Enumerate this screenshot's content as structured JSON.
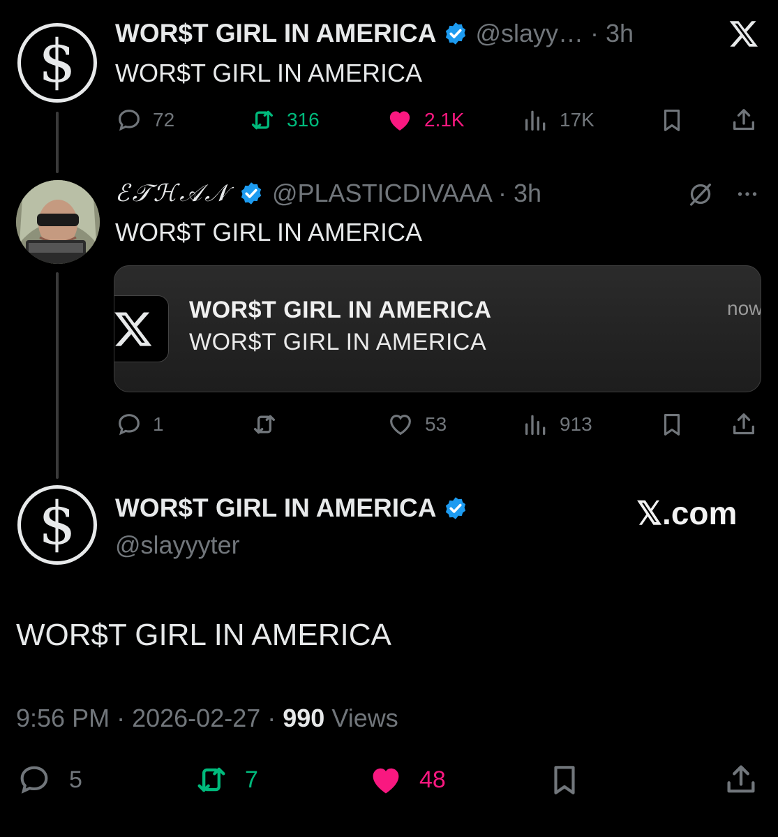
{
  "tweet1": {
    "name": "WOR$T GIRL IN AMERICA",
    "handle_time": "@slayy… · 3h",
    "text": "WOR$T GIRL IN AMERICA",
    "replies": "72",
    "retweets": "316",
    "likes": "2.1K",
    "views": "17K",
    "avatar_icon": "dollar-sign-icon"
  },
  "tweet2": {
    "name": "ℰ𝒯ℋ𝒜𝒩",
    "handle_time": "@PLASTICDIVAAA · 3h",
    "text": "WOR$T GIRL IN AMERICA",
    "replies": "1",
    "likes": "53",
    "views": "913",
    "notification": {
      "title": "WOR$T GIRL IN AMERICA",
      "body": "WOR$T GIRL IN AMERICA",
      "time": "now"
    }
  },
  "main_tweet": {
    "name": "WOR$T GIRL IN AMERICA",
    "handle": "@slayyyter",
    "text": "WOR$T GIRL IN AMERICA",
    "time": "9:56 PM",
    "date": "2026-02-27",
    "views_count": "990",
    "views_label": "Views",
    "replies": "5",
    "retweets": "7",
    "likes": "48"
  },
  "brand": {
    "xcom_label": "𝕏.com"
  },
  "colors": {
    "background": "#000000",
    "verified": "#1d9bf0",
    "retweet_green": "#00ba7c",
    "like_pink": "#f91880",
    "muted": "#71767b"
  }
}
